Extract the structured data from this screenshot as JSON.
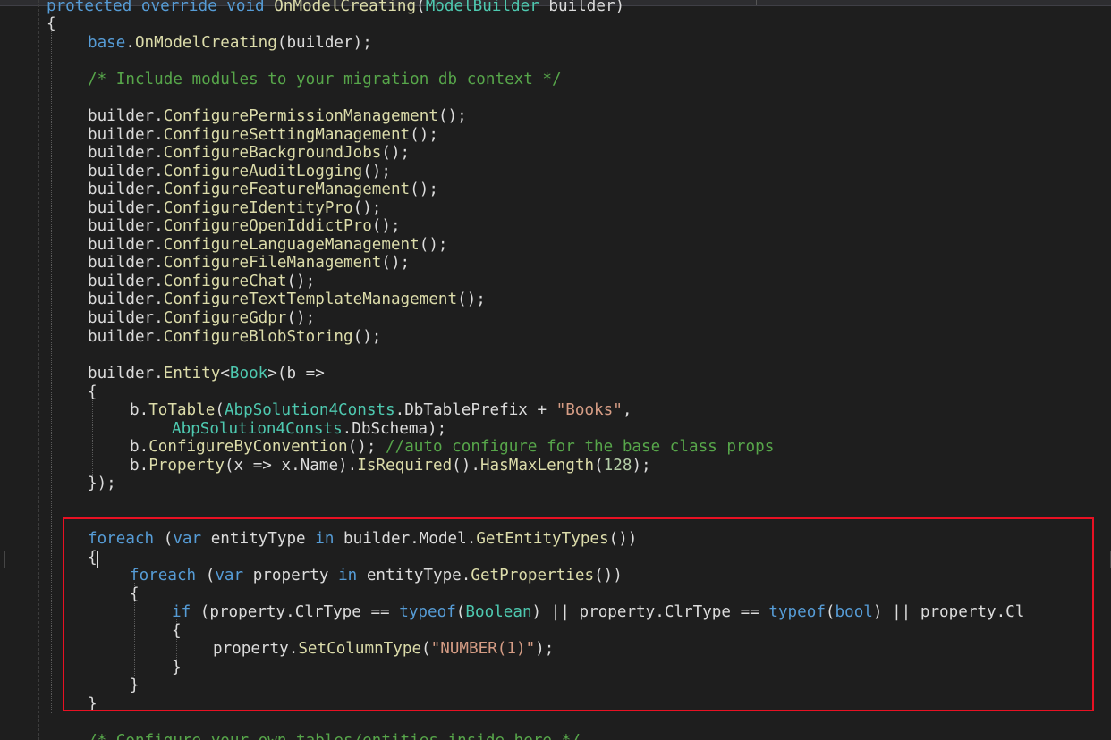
{
  "editor": {
    "language": "C#",
    "colors": {
      "keyword": "#569cd6",
      "type": "#4ec9b0",
      "method": "#dcdcaa",
      "string": "#d69d85",
      "comment": "#57a64a",
      "plain": "#dcdcdc",
      "highlight_box": "#e81123"
    },
    "lines": [
      {
        "indent": 0,
        "tokens": [
          [
            "kw",
            "protected override void "
          ],
          [
            "fn",
            "OnModelCreating"
          ],
          [
            "txt",
            "("
          ],
          [
            "cls",
            "ModelBuilder"
          ],
          [
            "txt",
            " builder)"
          ]
        ]
      },
      {
        "indent": 0,
        "tokens": [
          [
            "txt",
            "{"
          ]
        ]
      },
      {
        "indent": 1,
        "tokens": [
          [
            "kw",
            "base"
          ],
          [
            "txt",
            "."
          ],
          [
            "fn",
            "OnModelCreating"
          ],
          [
            "txt",
            "(builder);"
          ]
        ]
      },
      {
        "indent": 1,
        "tokens": [
          [
            "cm",
            "/* Include modules to your migration db context */"
          ]
        ]
      },
      {
        "indent": 1,
        "tokens": [
          [
            "txt",
            "builder."
          ],
          [
            "fn",
            "ConfigurePermissionManagement"
          ],
          [
            "txt",
            "();"
          ]
        ]
      },
      {
        "indent": 1,
        "tokens": [
          [
            "txt",
            "builder."
          ],
          [
            "fn",
            "ConfigureSettingManagement"
          ],
          [
            "txt",
            "();"
          ]
        ]
      },
      {
        "indent": 1,
        "tokens": [
          [
            "txt",
            "builder."
          ],
          [
            "fn",
            "ConfigureBackgroundJobs"
          ],
          [
            "txt",
            "();"
          ]
        ]
      },
      {
        "indent": 1,
        "tokens": [
          [
            "txt",
            "builder."
          ],
          [
            "fn",
            "ConfigureAuditLogging"
          ],
          [
            "txt",
            "();"
          ]
        ]
      },
      {
        "indent": 1,
        "tokens": [
          [
            "txt",
            "builder."
          ],
          [
            "fn",
            "ConfigureFeatureManagement"
          ],
          [
            "txt",
            "();"
          ]
        ]
      },
      {
        "indent": 1,
        "tokens": [
          [
            "txt",
            "builder."
          ],
          [
            "fn",
            "ConfigureIdentityPro"
          ],
          [
            "txt",
            "();"
          ]
        ]
      },
      {
        "indent": 1,
        "tokens": [
          [
            "txt",
            "builder."
          ],
          [
            "fn",
            "ConfigureOpenIddictPro"
          ],
          [
            "txt",
            "();"
          ]
        ]
      },
      {
        "indent": 1,
        "tokens": [
          [
            "txt",
            "builder."
          ],
          [
            "fn",
            "ConfigureLanguageManagement"
          ],
          [
            "txt",
            "();"
          ]
        ]
      },
      {
        "indent": 1,
        "tokens": [
          [
            "txt",
            "builder."
          ],
          [
            "fn",
            "ConfigureFileManagement"
          ],
          [
            "txt",
            "();"
          ]
        ]
      },
      {
        "indent": 1,
        "tokens": [
          [
            "txt",
            "builder."
          ],
          [
            "fn",
            "ConfigureChat"
          ],
          [
            "txt",
            "();"
          ]
        ]
      },
      {
        "indent": 1,
        "tokens": [
          [
            "txt",
            "builder."
          ],
          [
            "fn",
            "ConfigureTextTemplateManagement"
          ],
          [
            "txt",
            "();"
          ]
        ]
      },
      {
        "indent": 1,
        "tokens": [
          [
            "txt",
            "builder."
          ],
          [
            "fn",
            "ConfigureGdpr"
          ],
          [
            "txt",
            "();"
          ]
        ]
      },
      {
        "indent": 1,
        "tokens": [
          [
            "txt",
            "builder."
          ],
          [
            "fn",
            "ConfigureBlobStoring"
          ],
          [
            "txt",
            "();"
          ]
        ]
      },
      {
        "indent": 1,
        "tokens": [
          [
            "txt",
            "builder."
          ],
          [
            "fn",
            "Entity"
          ],
          [
            "txt",
            "<"
          ],
          [
            "cls",
            "Book"
          ],
          [
            "txt",
            ">(b =>"
          ]
        ]
      },
      {
        "indent": 1,
        "tokens": [
          [
            "txt",
            "{"
          ]
        ]
      },
      {
        "indent": 2,
        "tokens": [
          [
            "txt",
            "b."
          ],
          [
            "fn",
            "ToTable"
          ],
          [
            "txt",
            "("
          ],
          [
            "cls",
            "AbpSolution4Consts"
          ],
          [
            "txt",
            ".DbTablePrefix + "
          ],
          [
            "str",
            "\"Books\""
          ],
          [
            "txt",
            ","
          ]
        ]
      },
      {
        "indent": 3,
        "tokens": [
          [
            "cls",
            "AbpSolution4Consts"
          ],
          [
            "txt",
            ".DbSchema);"
          ]
        ]
      },
      {
        "indent": 2,
        "tokens": [
          [
            "txt",
            "b."
          ],
          [
            "fn",
            "ConfigureByConvention"
          ],
          [
            "txt",
            "(); "
          ],
          [
            "cm",
            "//auto configure for the base class props"
          ]
        ]
      },
      {
        "indent": 2,
        "tokens": [
          [
            "txt",
            "b."
          ],
          [
            "fn",
            "Property"
          ],
          [
            "txt",
            "(x => x.Name)."
          ],
          [
            "fn",
            "IsRequired"
          ],
          [
            "txt",
            "()."
          ],
          [
            "fn",
            "HasMaxLength"
          ],
          [
            "txt",
            "("
          ],
          [
            "num",
            "128"
          ],
          [
            "txt",
            ");"
          ]
        ]
      },
      {
        "indent": 1,
        "tokens": [
          [
            "txt",
            "});"
          ]
        ]
      },
      {
        "indent": 1,
        "tokens": [
          [
            "kw",
            "foreach"
          ],
          [
            "txt",
            " ("
          ],
          [
            "kw",
            "var"
          ],
          [
            "txt",
            " entityType "
          ],
          [
            "kw",
            "in"
          ],
          [
            "txt",
            " builder.Model."
          ],
          [
            "fn",
            "GetEntityTypes"
          ],
          [
            "txt",
            "())"
          ]
        ]
      },
      {
        "indent": 1,
        "tokens": [
          [
            "txt",
            "{"
          ]
        ]
      },
      {
        "indent": 2,
        "tokens": [
          [
            "kw",
            "foreach"
          ],
          [
            "txt",
            " ("
          ],
          [
            "kw",
            "var"
          ],
          [
            "txt",
            " property "
          ],
          [
            "kw",
            "in"
          ],
          [
            "txt",
            " entityType."
          ],
          [
            "fn",
            "GetProperties"
          ],
          [
            "txt",
            "())"
          ]
        ]
      },
      {
        "indent": 2,
        "tokens": [
          [
            "txt",
            "{"
          ]
        ]
      },
      {
        "indent": 3,
        "tokens": [
          [
            "kw",
            "if"
          ],
          [
            "txt",
            " (property.ClrType == "
          ],
          [
            "kw",
            "typeof"
          ],
          [
            "txt",
            "("
          ],
          [
            "cls",
            "Boolean"
          ],
          [
            "txt",
            ") || property.ClrType == "
          ],
          [
            "kw",
            "typeof"
          ],
          [
            "txt",
            "("
          ],
          [
            "kw",
            "bool"
          ],
          [
            "txt",
            ") || property.Cl"
          ]
        ]
      },
      {
        "indent": 3,
        "tokens": [
          [
            "txt",
            "{"
          ]
        ]
      },
      {
        "indent": 4,
        "tokens": [
          [
            "txt",
            "property."
          ],
          [
            "fn",
            "SetColumnType"
          ],
          [
            "txt",
            "("
          ],
          [
            "str",
            "\"NUMBER(1)\""
          ],
          [
            "txt",
            ");"
          ]
        ]
      },
      {
        "indent": 3,
        "tokens": [
          [
            "txt",
            "}"
          ]
        ]
      },
      {
        "indent": 2,
        "tokens": [
          [
            "txt",
            "}"
          ]
        ]
      },
      {
        "indent": 1,
        "tokens": [
          [
            "txt",
            "}"
          ]
        ]
      },
      {
        "indent": 1,
        "tokens": [
          [
            "cm",
            "/* Configure your own tables/entities inside here */"
          ]
        ]
      }
    ]
  }
}
